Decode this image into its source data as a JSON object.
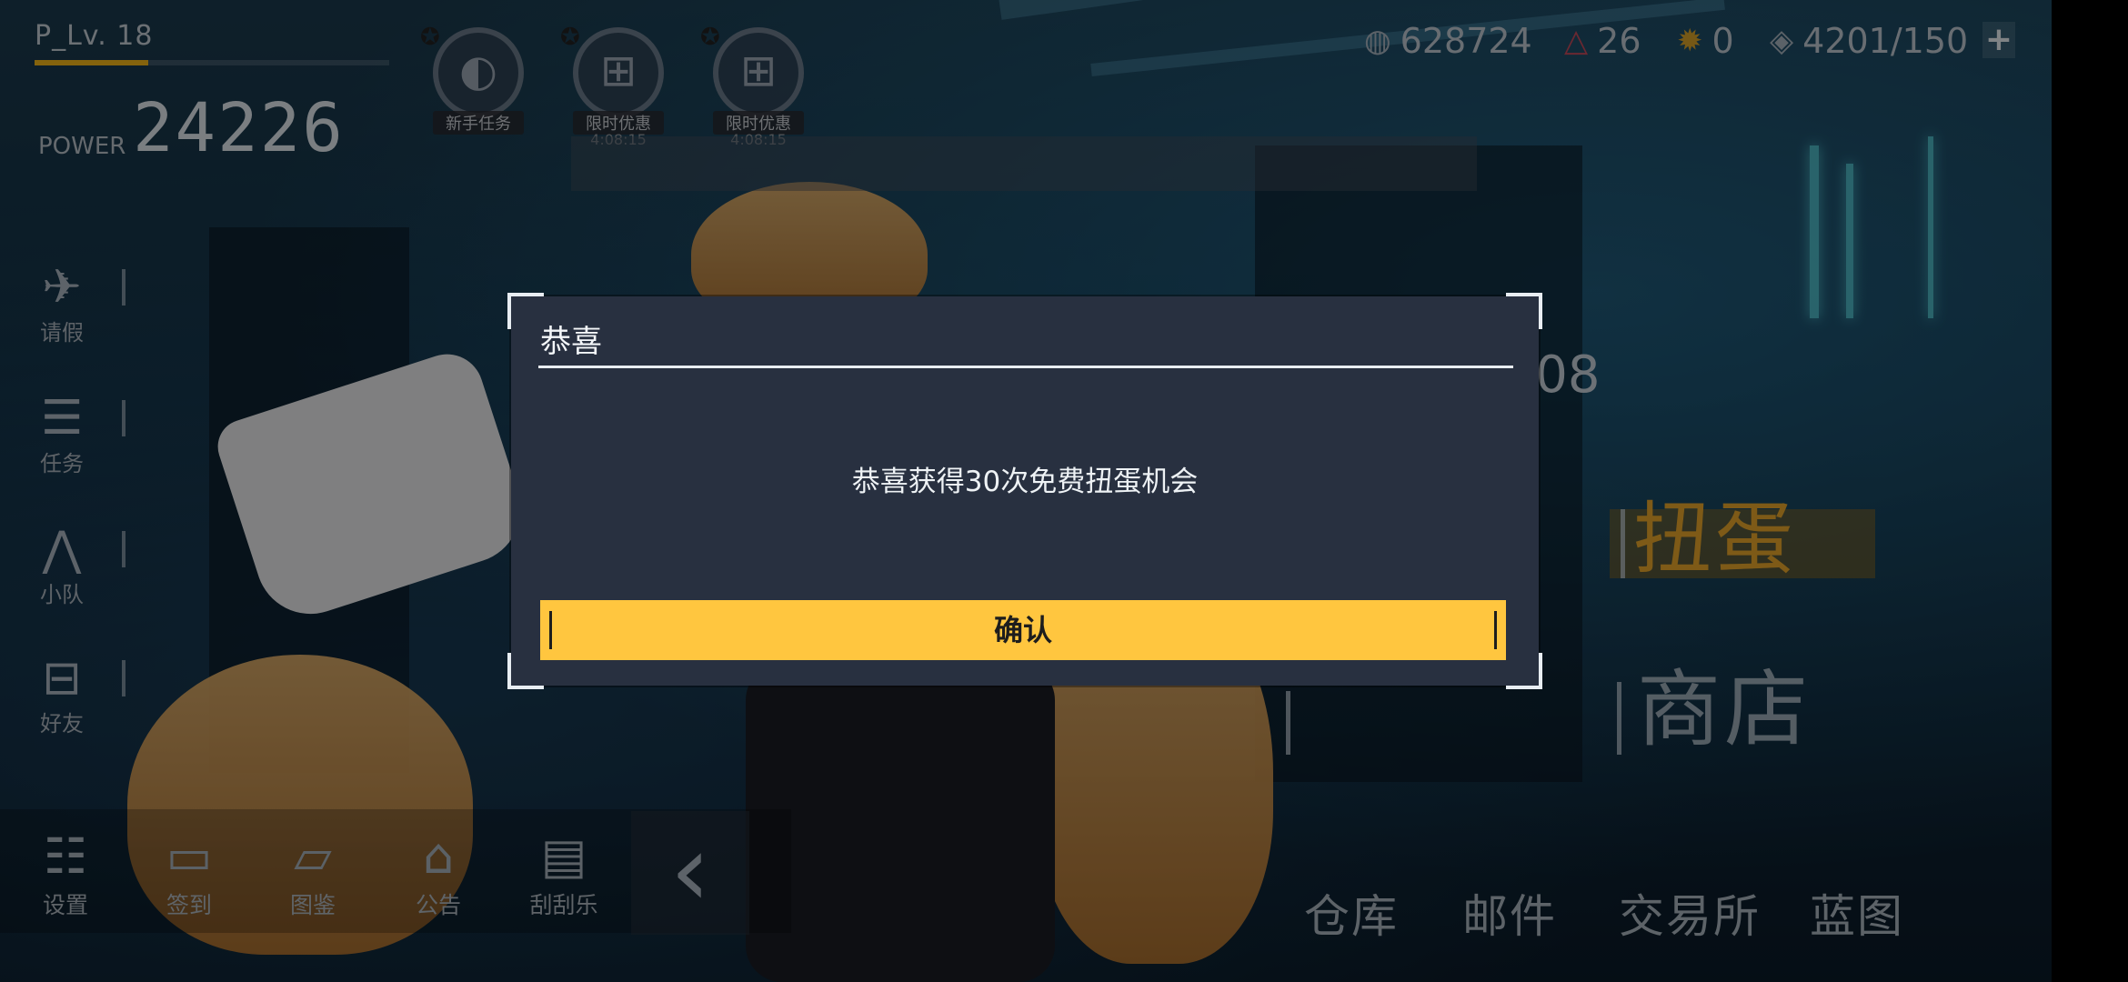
{
  "player": {
    "level": "P_Lv. 18",
    "level_progress": 0.32,
    "power_label": "POWER",
    "power_value": "24226"
  },
  "events": [
    {
      "icon": "newbie-quest-icon",
      "label": "新手任务",
      "timer": ""
    },
    {
      "icon": "gift-icon",
      "label": "限时优惠",
      "timer": "4:08:15"
    },
    {
      "icon": "gift-icon",
      "label": "限时优惠",
      "timer": "4:08:15"
    }
  ],
  "currencies": [
    {
      "icon": "water-drop-icon",
      "value": "628724"
    },
    {
      "icon": "triangle-gem-icon",
      "value": "26"
    },
    {
      "icon": "gear-coin-icon",
      "value": "0"
    },
    {
      "icon": "ticket-icon",
      "value": "4201/150"
    }
  ],
  "left_menu": [
    {
      "icon": "fish-icon",
      "label": "请假"
    },
    {
      "icon": "task-icon",
      "label": "任务"
    },
    {
      "icon": "team-icon",
      "label": "小队"
    },
    {
      "icon": "friends-icon",
      "label": "好友"
    }
  ],
  "bottom_left": [
    {
      "icon": "settings-icon",
      "label": "设置"
    },
    {
      "icon": "calendar-icon",
      "label": "签到"
    },
    {
      "icon": "folder-icon",
      "label": "图鉴"
    },
    {
      "icon": "notice-icon",
      "label": "公告"
    },
    {
      "icon": "scratch-card-icon",
      "label": "刮刮乐"
    }
  ],
  "bottom_right": [
    "仓库",
    "邮件",
    "交易所",
    "蓝图"
  ],
  "right_menu": {
    "gacha": "扭蛋",
    "shop": "商店",
    "date_suffix": "-08"
  },
  "modal": {
    "title": "恭喜",
    "message": "恭喜获得30次免费扭蛋机会",
    "confirm_label": "确认"
  },
  "colors": {
    "accent": "#ffc63f",
    "modal_bg": "#283040",
    "level_bar": "#f2b418",
    "gacha": "#e5a52a"
  }
}
